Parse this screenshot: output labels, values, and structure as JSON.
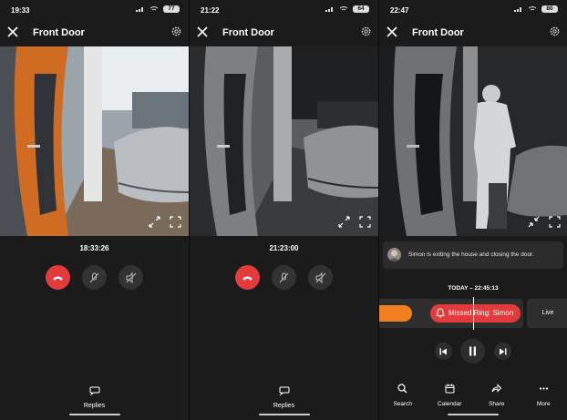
{
  "screens": [
    {
      "status": {
        "time": "19:33",
        "battery": "77"
      },
      "title": "Front Door",
      "timestamp": "18:33:26",
      "replies_label": "Replies"
    },
    {
      "status": {
        "time": "21:22",
        "battery": "64"
      },
      "title": "Front Door",
      "timestamp": "21:23:00",
      "replies_label": "Replies"
    },
    {
      "status": {
        "time": "22:47",
        "battery": "80"
      },
      "title": "Front Door",
      "activity_text": "Simon is exiting the house and closing the door.",
      "today_label": "TODAY – 22:45:13",
      "event_label": "Missed Ring: Simon",
      "live_label": "Live",
      "tabs": [
        "Search",
        "Calendar",
        "Share",
        "More"
      ]
    }
  ],
  "colors": {
    "end_call": "#e23b3b",
    "accent_orange": "#f07f20",
    "background": "#1b1b1b"
  },
  "icons": [
    "close-icon",
    "gear-icon",
    "expand-icon",
    "fullscreen-icon",
    "collapse-icon",
    "end-call-icon",
    "mic-muted-icon",
    "speaker-muted-icon",
    "chat-bubble-icon",
    "bell-icon",
    "skip-back-icon",
    "pause-icon",
    "skip-forward-icon",
    "search-icon",
    "calendar-icon",
    "share-icon",
    "more-icon"
  ]
}
